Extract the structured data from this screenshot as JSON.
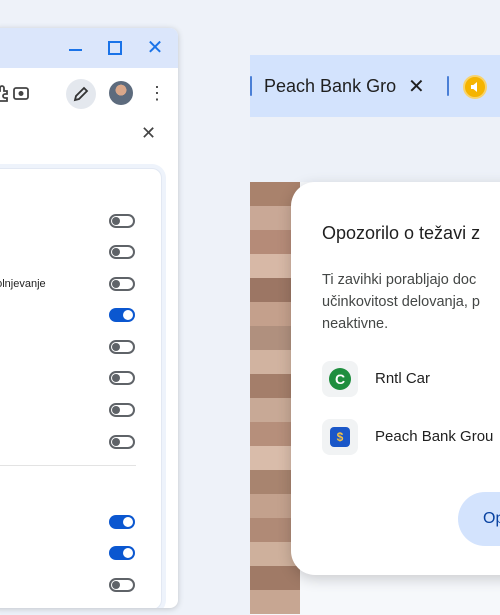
{
  "left_window": {
    "controls": {
      "minimize": "minimize-icon",
      "maximize": "maximize-icon",
      "close_glyph": "✕"
    },
    "toolbar_icons": [
      "extensions-icon",
      "screenshot-icon",
      "edit-icon",
      "avatar",
      "more-menu-icon"
    ],
    "panel_close_glyph": "✕",
    "setting_label": "polnjevanje",
    "toggles": [
      false,
      false,
      false,
      true,
      false,
      false,
      false,
      false,
      true,
      true,
      false,
      false
    ]
  },
  "right_window": {
    "tab": {
      "title": "Peach Bank Gro",
      "close_glyph": "✕"
    },
    "audio_icon": "audio-playing-icon"
  },
  "dialog": {
    "title": "Opozorilo o težavi z",
    "body_lines": [
      "Ti zavihki porabljajo doc",
      "učinkovitost delovanja, p",
      "neaktivne."
    ],
    "sites": [
      {
        "name": "Rntl Car",
        "logo_letter": "C",
        "color": "#1e8e3e"
      },
      {
        "name": "Peach Bank Grou",
        "logo_letter": "$",
        "color": "#1a57c8"
      }
    ],
    "button_label": "Op"
  },
  "colors": {
    "accent": "#0b57d0",
    "titlebar": "#dbe6fb",
    "tabbar": "#d3e3fd"
  }
}
